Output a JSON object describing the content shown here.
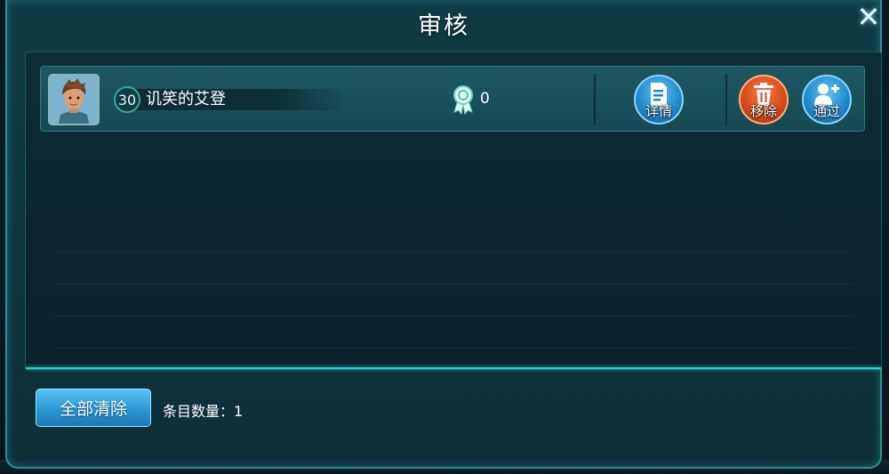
{
  "background": {
    "help_glyph": "?"
  },
  "dialog": {
    "title": "审核",
    "close_glyph": "✕"
  },
  "request": {
    "level": "30",
    "player_name": "讥笑的艾登",
    "medal_count": "0",
    "buttons": {
      "details": "详情",
      "remove": "移除",
      "approve": "通过"
    }
  },
  "footer": {
    "clear_all_label": "全部清除",
    "item_count_label": "条目数量：1"
  },
  "colors": {
    "accent_cyan": "#3ec6cc",
    "button_blue": "#2b98d6",
    "button_red": "#d4471a"
  },
  "icons": [
    "help-icon",
    "close-icon",
    "avatar",
    "medal-icon",
    "document-icon",
    "trash-icon",
    "add-user-icon"
  ]
}
